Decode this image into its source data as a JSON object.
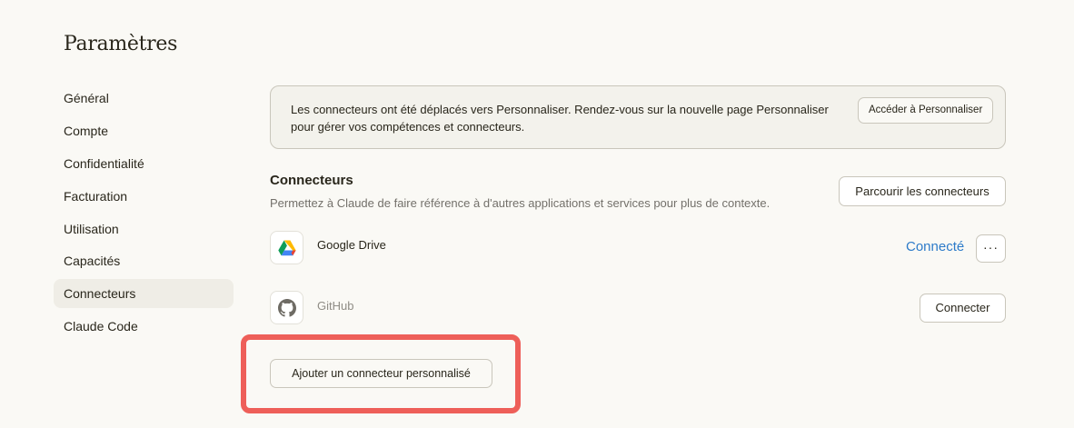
{
  "page": {
    "title": "Paramètres"
  },
  "sidebar": {
    "items": [
      {
        "label": "Général"
      },
      {
        "label": "Compte"
      },
      {
        "label": "Confidentialité"
      },
      {
        "label": "Facturation"
      },
      {
        "label": "Utilisation"
      },
      {
        "label": "Capacités"
      },
      {
        "label": "Connecteurs",
        "active": true
      },
      {
        "label": "Claude Code"
      }
    ]
  },
  "notice": {
    "line1": "Les connecteurs ont été déplacés vers Personnaliser. Rendez-vous sur la nouvelle page Personnaliser",
    "line2": "pour gérer vos compétences et connecteurs.",
    "button_label": "Accéder à Personnaliser"
  },
  "connectors_section": {
    "title": "Connecteurs",
    "description": "Permettez à Claude de faire référence à d'autres applications et services pour plus de contexte.",
    "browse_label": "Parcourir les connecteurs",
    "items": [
      {
        "name": "Google Drive",
        "icon": "google-drive-icon",
        "status": "Connecté",
        "more_label": "···"
      },
      {
        "name": "GitHub",
        "icon": "github-icon",
        "action_label": "Connecter"
      }
    ],
    "add_custom_label": "Ajouter un connecteur personnalisé"
  },
  "colors": {
    "background": "#faf9f5",
    "accent_link": "#2d7bc9",
    "highlight": "#ee5f59",
    "active_nav": "#efede6"
  }
}
